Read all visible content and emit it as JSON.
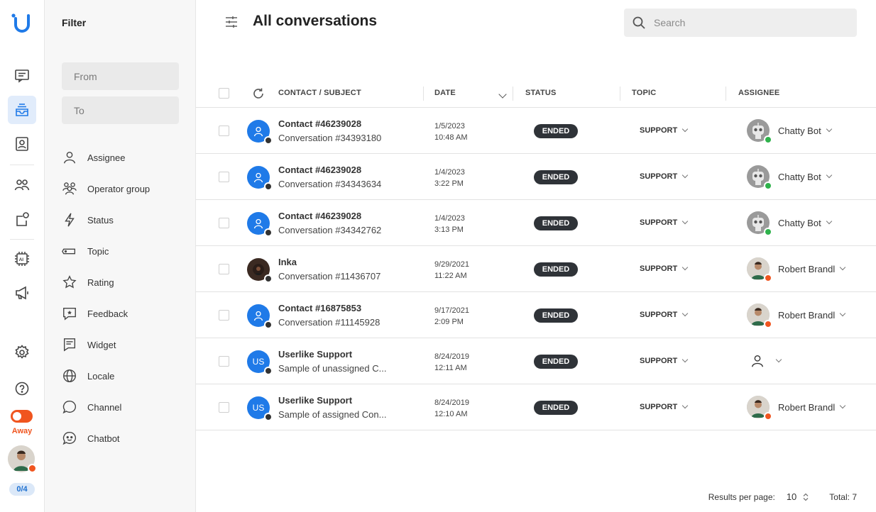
{
  "rail": {
    "status_label": "Away",
    "count_badge": "0/4",
    "icons": [
      "logo-icon",
      "chat-icon",
      "inbox-icon",
      "contacts-icon",
      "team-icon",
      "tasks-icon",
      "ai-icon",
      "megaphone-icon",
      "gear-icon",
      "help-icon"
    ]
  },
  "filter": {
    "title": "Filter",
    "from_placeholder": "From",
    "to_placeholder": "To",
    "items": [
      {
        "label": "Assignee",
        "icon": "person-icon"
      },
      {
        "label": "Operator group",
        "icon": "group-icon"
      },
      {
        "label": "Status",
        "icon": "bolt-icon"
      },
      {
        "label": "Topic",
        "icon": "tag-icon"
      },
      {
        "label": "Rating",
        "icon": "star-icon"
      },
      {
        "label": "Feedback",
        "icon": "feedback-icon"
      },
      {
        "label": "Widget",
        "icon": "widget-icon"
      },
      {
        "label": "Locale",
        "icon": "globe-icon"
      },
      {
        "label": "Channel",
        "icon": "chat-bubble-icon"
      },
      {
        "label": "Chatbot",
        "icon": "bot-face-icon"
      }
    ]
  },
  "header": {
    "title": "All conversations",
    "search_placeholder": "Search"
  },
  "table": {
    "columns": {
      "contact": "CONTACT / SUBJECT",
      "date": "DATE",
      "status": "STATUS",
      "topic": "TOPIC",
      "assignee": "ASSIGNEE"
    },
    "rows": [
      {
        "contact": "Contact #46239028",
        "subject": "Conversation #34393180",
        "date": "1/5/2023",
        "time": "10:48 AM",
        "status": "ENDED",
        "topic": "SUPPORT",
        "assignee": "Chatty Bot",
        "avatar": "user-icon",
        "assignee_type": "bot"
      },
      {
        "contact": "Contact #46239028",
        "subject": "Conversation #34343634",
        "date": "1/4/2023",
        "time": "3:22 PM",
        "status": "ENDED",
        "topic": "SUPPORT",
        "assignee": "Chatty Bot",
        "avatar": "user-icon",
        "assignee_type": "bot"
      },
      {
        "contact": "Contact #46239028",
        "subject": "Conversation #34342762",
        "date": "1/4/2023",
        "time": "3:13 PM",
        "status": "ENDED",
        "topic": "SUPPORT",
        "assignee": "Chatty Bot",
        "avatar": "user-icon",
        "assignee_type": "bot"
      },
      {
        "contact": "Inka",
        "subject": "Conversation #11436707",
        "date": "9/29/2021",
        "time": "11:22 AM",
        "status": "ENDED",
        "topic": "SUPPORT",
        "assignee": "Robert Brandl",
        "avatar": "photo",
        "assignee_type": "person"
      },
      {
        "contact": "Contact #16875853",
        "subject": "Conversation #11145928",
        "date": "9/17/2021",
        "time": "2:09 PM",
        "status": "ENDED",
        "topic": "SUPPORT",
        "assignee": "Robert Brandl",
        "avatar": "user-icon",
        "assignee_type": "person"
      },
      {
        "contact": "Userlike Support",
        "subject": "Sample of unassigned C...",
        "date": "8/24/2019",
        "time": "12:11 AM",
        "status": "ENDED",
        "topic": "SUPPORT",
        "assignee": "",
        "avatar": "US",
        "assignee_type": "none"
      },
      {
        "contact": "Userlike Support",
        "subject": "Sample of assigned Con...",
        "date": "8/24/2019",
        "time": "12:10 AM",
        "status": "ENDED",
        "topic": "SUPPORT",
        "assignee": "Robert Brandl",
        "avatar": "US",
        "assignee_type": "person"
      }
    ]
  },
  "footer": {
    "per_page_label": "Results per page:",
    "per_page_value": "10",
    "total": "Total: 7"
  },
  "colors": {
    "accent": "#1f7ae8",
    "away": "#f0551f",
    "online": "#2fb24c",
    "status_badge": "#2f3338"
  }
}
